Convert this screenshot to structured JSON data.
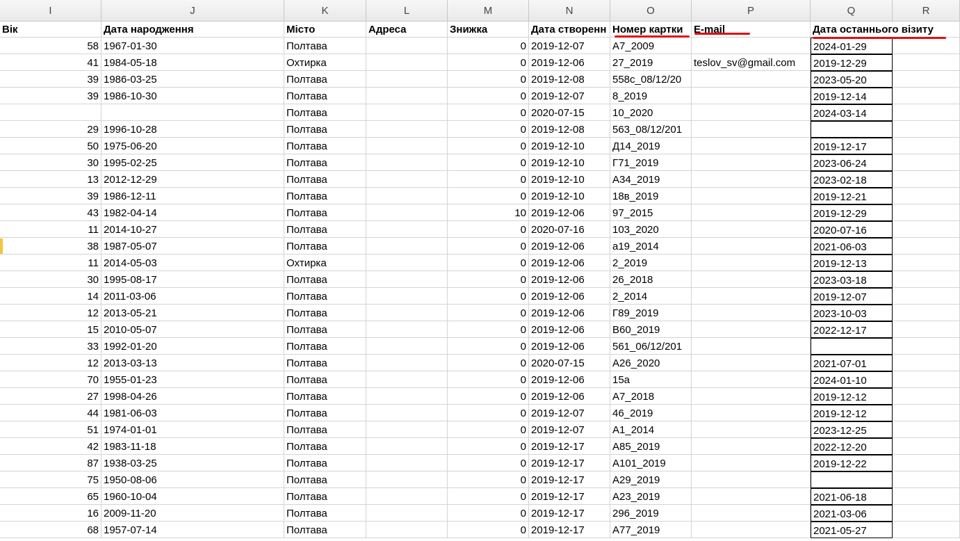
{
  "column_headers": [
    "I",
    "J",
    "K",
    "L",
    "M",
    "N",
    "O",
    "P",
    "Q",
    "R"
  ],
  "header_row": {
    "age": "Вік",
    "birth_date": "Дата народження",
    "city": "Місто",
    "address": "Адреса",
    "discount": "Знижка",
    "created_date": "Дата створенн",
    "card_number": "Номер картки",
    "email": "E-mail",
    "last_visit": "Дата останнього візиту"
  },
  "rows": [
    {
      "age": "58",
      "birth": "1967-01-30",
      "city": "Полтава",
      "address": "",
      "discount": "0",
      "created": "2019-12-07",
      "card": "А7_2009",
      "email": "",
      "last_visit": "2024-01-29"
    },
    {
      "age": "41",
      "birth": "1984-05-18",
      "city": "Охтирка",
      "address": "",
      "discount": "0",
      "created": "2019-12-06",
      "card": "27_2019",
      "email": "teslov_sv@gmail.com",
      "last_visit": "2019-12-29"
    },
    {
      "age": "39",
      "birth": "1986-03-25",
      "city": "Полтава",
      "address": "",
      "discount": "0",
      "created": "2019-12-08",
      "card": "558с_08/12/20",
      "email": "",
      "last_visit": "2023-05-20"
    },
    {
      "age": "39",
      "birth": "1986-10-30",
      "city": "Полтава",
      "address": "",
      "discount": "0",
      "created": "2019-12-07",
      "card": "8_2019",
      "email": "",
      "last_visit": "2019-12-14"
    },
    {
      "age": "",
      "birth": "",
      "city": "Полтава",
      "address": "",
      "discount": "0",
      "created": "2020-07-15",
      "card": "10_2020",
      "email": "",
      "last_visit": "2024-03-14"
    },
    {
      "age": "29",
      "birth": "1996-10-28",
      "city": "Полтава",
      "address": "",
      "discount": "0",
      "created": "2019-12-08",
      "card": "563_08/12/201",
      "email": "",
      "last_visit": ""
    },
    {
      "age": "50",
      "birth": "1975-06-20",
      "city": "Полтава",
      "address": "",
      "discount": "0",
      "created": "2019-12-10",
      "card": "Д14_2019",
      "email": "",
      "last_visit": "2019-12-17"
    },
    {
      "age": "30",
      "birth": "1995-02-25",
      "city": "Полтава",
      "address": "",
      "discount": "0",
      "created": "2019-12-10",
      "card": "Г71_2019",
      "email": "",
      "last_visit": "2023-06-24"
    },
    {
      "age": "13",
      "birth": "2012-12-29",
      "city": "Полтава",
      "address": "",
      "discount": "0",
      "created": "2019-12-10",
      "card": "А34_2019",
      "email": "",
      "last_visit": "2023-02-18"
    },
    {
      "age": "39",
      "birth": "1986-12-11",
      "city": "Полтава",
      "address": "",
      "discount": "0",
      "created": "2019-12-10",
      "card": "18в_2019",
      "email": "",
      "last_visit": "2019-12-21"
    },
    {
      "age": "43",
      "birth": "1982-04-14",
      "city": "Полтава",
      "address": "",
      "discount": "10",
      "created": "2019-12-06",
      "card": "97_2015",
      "email": "",
      "last_visit": "2019-12-29"
    },
    {
      "age": "11",
      "birth": "2014-10-27",
      "city": "Полтава",
      "address": "",
      "discount": "0",
      "created": "2020-07-16",
      "card": "103_2020",
      "email": "",
      "last_visit": "2020-07-16"
    },
    {
      "age": "38",
      "birth": "1987-05-07",
      "city": "Полтава",
      "address": "",
      "discount": "0",
      "created": "2019-12-06",
      "card": "а19_2014",
      "email": "",
      "last_visit": "2021-06-03"
    },
    {
      "age": "11",
      "birth": "2014-05-03",
      "city": "Охтирка",
      "address": "",
      "discount": "0",
      "created": "2019-12-06",
      "card": "2_2019",
      "email": "",
      "last_visit": "2019-12-13"
    },
    {
      "age": "30",
      "birth": "1995-08-17",
      "city": "Полтава",
      "address": "",
      "discount": "0",
      "created": "2019-12-06",
      "card": "26_2018",
      "email": "",
      "last_visit": "2023-03-18"
    },
    {
      "age": "14",
      "birth": "2011-03-06",
      "city": "Полтава",
      "address": "",
      "discount": "0",
      "created": "2019-12-06",
      "card": "2_2014",
      "email": "",
      "last_visit": "2019-12-07"
    },
    {
      "age": "12",
      "birth": "2013-05-21",
      "city": "Полтава",
      "address": "",
      "discount": "0",
      "created": "2019-12-06",
      "card": "Г89_2019",
      "email": "",
      "last_visit": "2023-10-03"
    },
    {
      "age": "15",
      "birth": "2010-05-07",
      "city": "Полтава",
      "address": "",
      "discount": "0",
      "created": "2019-12-06",
      "card": "В60_2019",
      "email": "",
      "last_visit": "2022-12-17"
    },
    {
      "age": "33",
      "birth": "1992-01-20",
      "city": "Полтава",
      "address": "",
      "discount": "0",
      "created": "2019-12-06",
      "card": "561_06/12/201",
      "email": "",
      "last_visit": ""
    },
    {
      "age": "12",
      "birth": "2013-03-13",
      "city": "Полтава",
      "address": "",
      "discount": "0",
      "created": "2020-07-15",
      "card": "А26_2020",
      "email": "",
      "last_visit": "2021-07-01"
    },
    {
      "age": "70",
      "birth": "1955-01-23",
      "city": "Полтава",
      "address": "",
      "discount": "0",
      "created": "2019-12-06",
      "card": "15а",
      "email": "",
      "last_visit": "2024-01-10"
    },
    {
      "age": "27",
      "birth": "1998-04-26",
      "city": "Полтава",
      "address": "",
      "discount": "0",
      "created": "2019-12-06",
      "card": "А7_2018",
      "email": "",
      "last_visit": "2019-12-12"
    },
    {
      "age": "44",
      "birth": "1981-06-03",
      "city": "Полтава",
      "address": "",
      "discount": "0",
      "created": "2019-12-07",
      "card": "46_2019",
      "email": "",
      "last_visit": "2019-12-12"
    },
    {
      "age": "51",
      "birth": "1974-01-01",
      "city": "Полтава",
      "address": "",
      "discount": "0",
      "created": "2019-12-07",
      "card": "А1_2014",
      "email": "",
      "last_visit": "2023-12-25"
    },
    {
      "age": "42",
      "birth": "1983-11-18",
      "city": "Полтава",
      "address": "",
      "discount": "0",
      "created": "2019-12-17",
      "card": "А85_2019",
      "email": "",
      "last_visit": "2022-12-20"
    },
    {
      "age": "87",
      "birth": "1938-03-25",
      "city": "Полтава",
      "address": "",
      "discount": "0",
      "created": "2019-12-17",
      "card": "А101_2019",
      "email": "",
      "last_visit": "2019-12-22"
    },
    {
      "age": "75",
      "birth": "1950-08-06",
      "city": "Полтава",
      "address": "",
      "discount": "0",
      "created": "2019-12-17",
      "card": "А29_2019",
      "email": "",
      "last_visit": ""
    },
    {
      "age": "65",
      "birth": "1960-10-04",
      "city": "Полтава",
      "address": "",
      "discount": "0",
      "created": "2019-12-17",
      "card": "А23_2019",
      "email": "",
      "last_visit": "2021-06-18"
    },
    {
      "age": "16",
      "birth": "2009-11-20",
      "city": "Полтава",
      "address": "",
      "discount": "0",
      "created": "2019-12-17",
      "card": "296_2019",
      "email": "",
      "last_visit": "2021-03-06"
    },
    {
      "age": "68",
      "birth": "1957-07-14",
      "city": "Полтава",
      "address": "",
      "discount": "0",
      "created": "2019-12-17",
      "card": "А77_2019",
      "email": "",
      "last_visit": "2021-05-27"
    }
  ],
  "colors": {
    "header_bg": "#f0f0f0",
    "grid": "#d4d4d4",
    "annotation": "#e01010",
    "row_marker": "#f6c343"
  }
}
